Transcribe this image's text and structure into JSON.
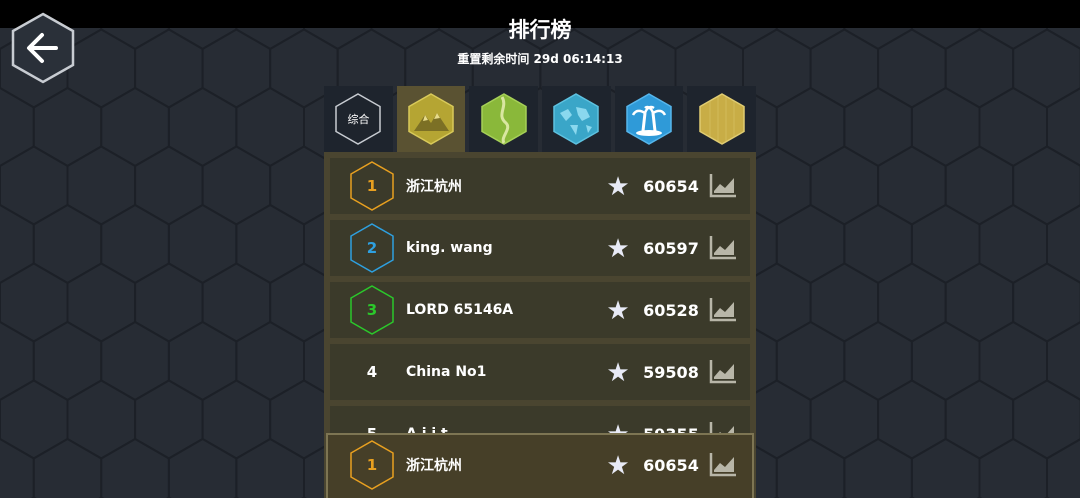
{
  "header": {
    "title": "排行榜",
    "reset_text": "重置剩余时间 29d 06:14:13"
  },
  "tabs": [
    {
      "label": "综合",
      "icon": "overall-hex-icon",
      "active": false
    },
    {
      "icon": "mountain-hex-icon",
      "active": true
    },
    {
      "icon": "grassland-hex-icon",
      "active": false
    },
    {
      "icon": "world-map-hex-icon",
      "active": false
    },
    {
      "icon": "palm-island-hex-icon",
      "active": false
    },
    {
      "icon": "gold-hex-icon",
      "active": false
    }
  ],
  "leaderboard": [
    {
      "rank": "1",
      "name": "浙江杭州",
      "score": "60654",
      "rank_color": "#e8a020"
    },
    {
      "rank": "2",
      "name": "king. wang",
      "score": "60597",
      "rank_color": "#2ea0e0"
    },
    {
      "rank": "3",
      "name": "LORD 65146A",
      "score": "60528",
      "rank_color": "#2bc82b"
    },
    {
      "rank": "4",
      "name": "China No1",
      "score": "59508",
      "rank_color": "#ffffff"
    },
    {
      "rank": "5",
      "name": "A  j  i  t",
      "score": "59355",
      "rank_color": "#ffffff"
    }
  ],
  "self_entry": {
    "rank": "1",
    "name": "浙江杭州",
    "score": "60654",
    "rank_color": "#e8a020"
  },
  "colors": {
    "background": "#262b33",
    "board": "#4a4530",
    "row": "#3b3a2a",
    "active_tab": "#5a5232"
  }
}
